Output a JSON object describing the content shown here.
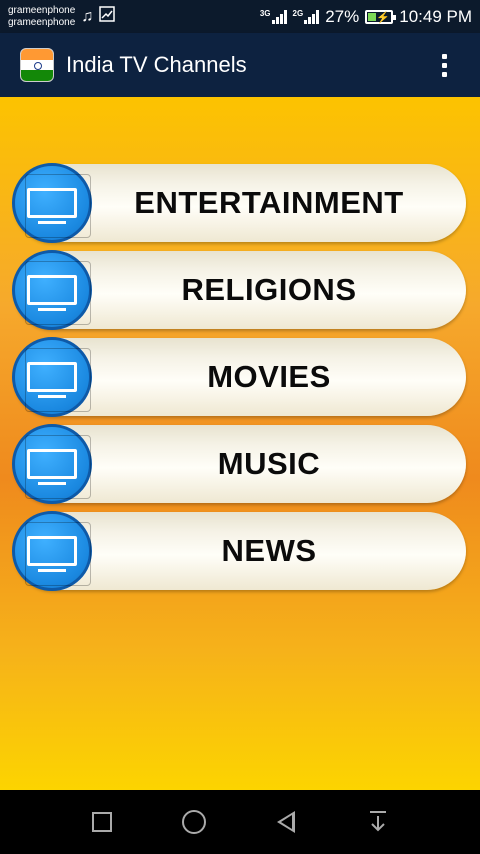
{
  "status_bar": {
    "carrier_1": "grameenphone",
    "carrier_2": "grameenphone",
    "network_1": "3G",
    "network_2": "2G",
    "battery_percent": "27%",
    "time": "10:49 PM"
  },
  "app_bar": {
    "title": "India TV Channels"
  },
  "categories": [
    {
      "label": "ENTERTAINMENT"
    },
    {
      "label": "RELIGIONS"
    },
    {
      "label": "MOVIES"
    },
    {
      "label": "MUSIC"
    },
    {
      "label": "NEWS"
    }
  ],
  "colors": {
    "app_bar": "#0d2240",
    "tv_badge": "#1a88e0",
    "content_gradient_top": "#fcc300",
    "content_gradient_mid": "#ef8a1d"
  }
}
